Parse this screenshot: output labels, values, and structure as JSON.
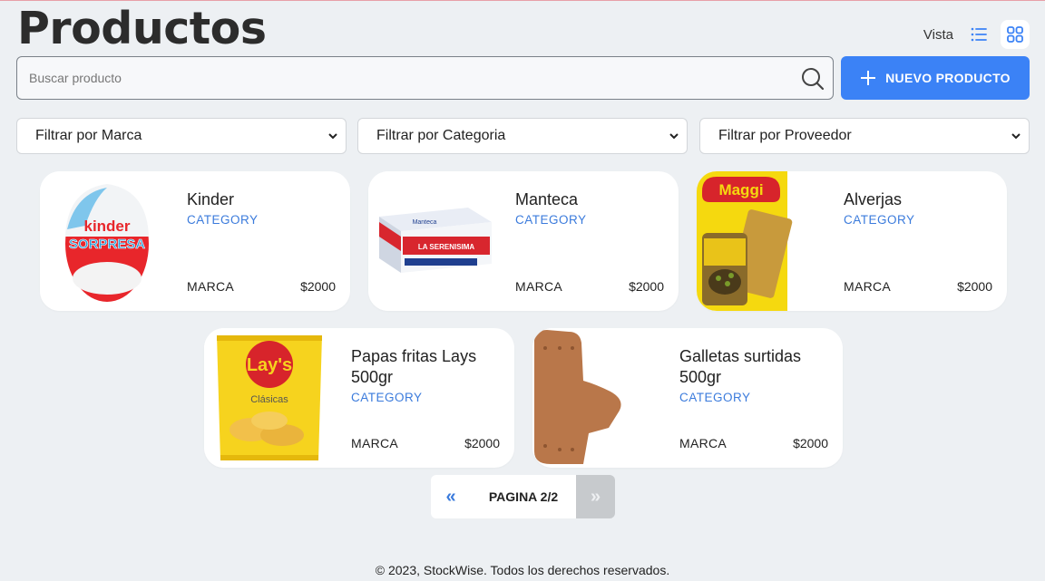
{
  "header": {
    "title": "Productos",
    "view_label": "Vista"
  },
  "search": {
    "placeholder": "Buscar producto",
    "value": ""
  },
  "new_button": {
    "label": "NUEVO PRODUCTO"
  },
  "filters": [
    {
      "label": "Filtrar por Marca"
    },
    {
      "label": "Filtrar por Categoria"
    },
    {
      "label": "Filtrar por Proveedor"
    }
  ],
  "products": [
    {
      "name": "Kinder",
      "category": "CATEGORY",
      "brand": "MARCA",
      "price": "$2000",
      "image_icon": "kinder-egg"
    },
    {
      "name": "Manteca",
      "category": "CATEGORY",
      "brand": "MARCA",
      "price": "$2000",
      "image_icon": "butter-pack"
    },
    {
      "name": "Alverjas",
      "category": "CATEGORY",
      "brand": "MARCA",
      "price": "$2000",
      "image_icon": "maggi-jar"
    },
    {
      "name": "Papas fritas Lays 500gr",
      "category": "CATEGORY",
      "brand": "MARCA",
      "price": "$2000",
      "image_icon": "chips-bag"
    },
    {
      "name": "Galletas surtidas 500gr",
      "category": "CATEGORY",
      "brand": "MARCA",
      "price": "$2000",
      "image_icon": "cookie"
    }
  ],
  "image_text": {
    "kinder_brand": "kinder",
    "kinder_sub": "SORPRESA",
    "butter_brand": "LA SERENISIMA",
    "butter_label": "Manteca",
    "maggi_brand": "Maggi",
    "lays_brand": "Lay's",
    "lays_sub": "Clásicas"
  },
  "pagination": {
    "prev": "«",
    "label": "PAGINA 2/2",
    "next": "»"
  },
  "footer": {
    "text": "© 2023, StockWise. Todos los derechos reservados."
  },
  "colors": {
    "accent": "#3b82f6",
    "background": "#edf0f3",
    "category": "#3b7bdc"
  }
}
